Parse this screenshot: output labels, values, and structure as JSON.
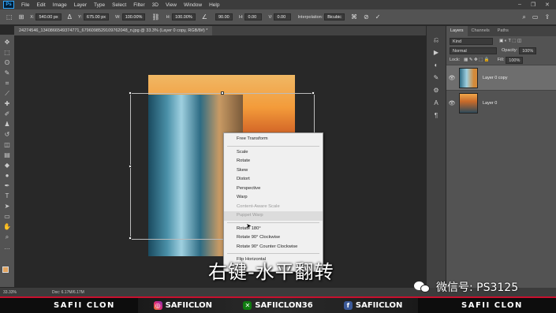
{
  "menubar": {
    "logo": "Ps",
    "items": [
      "File",
      "Edit",
      "Image",
      "Layer",
      "Type",
      "Select",
      "Filter",
      "3D",
      "View",
      "Window",
      "Help"
    ]
  },
  "options": {
    "x_label": "X:",
    "x_value": "540.00 px",
    "y_label": "Y:",
    "y_value": "675.00 px",
    "w_label": "W:",
    "w_value": "100.00%",
    "h_label": "H:",
    "h_value": "100.00%",
    "angle_value": "90.00",
    "hskew_label": "H:",
    "hskew_value": "0.00",
    "vskew_label": "V:",
    "vskew_value": "0.00",
    "interp_label": "Interpolation:",
    "interp_value": "Bicubic"
  },
  "document": {
    "tab_title": "24274546_1340866549374771_6796098529109762048_n.jpg @ 33.3% (Layer 0 copy, RGB/8#) *"
  },
  "context_menu": {
    "items": [
      {
        "label": "Free Transform",
        "disabled": false
      },
      {
        "sep": true
      },
      {
        "label": "Scale",
        "disabled": false
      },
      {
        "label": "Rotate",
        "disabled": false
      },
      {
        "label": "Skew",
        "disabled": false
      },
      {
        "label": "Distort",
        "disabled": false
      },
      {
        "label": "Perspective",
        "disabled": false
      },
      {
        "label": "Warp",
        "disabled": false
      },
      {
        "label": "Content-Aware Scale",
        "disabled": true
      },
      {
        "label": "Puppet Warp",
        "disabled": true
      },
      {
        "sep": true
      },
      {
        "label": "Rotate 180°",
        "disabled": false
      },
      {
        "label": "Rotate 90° Clockwise",
        "disabled": false
      },
      {
        "label": "Rotate 90° Counter Clockwise",
        "disabled": false
      },
      {
        "sep": true
      },
      {
        "label": "Flip Horizontal",
        "disabled": false
      }
    ]
  },
  "layers_panel": {
    "tabs": [
      "Layers",
      "Channels",
      "Paths"
    ],
    "kind_label": "Kind",
    "blend_mode": "Normal",
    "opacity_label": "Opacity:",
    "opacity_value": "100%",
    "lock_label": "Lock:",
    "fill_label": "Fill:",
    "fill_value": "100%",
    "layers": [
      {
        "name": "Layer 0 copy",
        "selected": true
      },
      {
        "name": "Layer 0",
        "selected": false
      }
    ]
  },
  "status": {
    "zoom": "33.33%",
    "doc": "Doc: 6.17M/6.17M"
  },
  "overlay": {
    "subtitle": "右键-水平翻转",
    "wechat": "微信号: PS3125"
  },
  "banner": {
    "left_name": "SAFII CLON",
    "instagram": "SAFIICLON",
    "xbox": "SAFIICLON36",
    "facebook": "SAFIICLON",
    "right_name": "SAFII CLON"
  }
}
